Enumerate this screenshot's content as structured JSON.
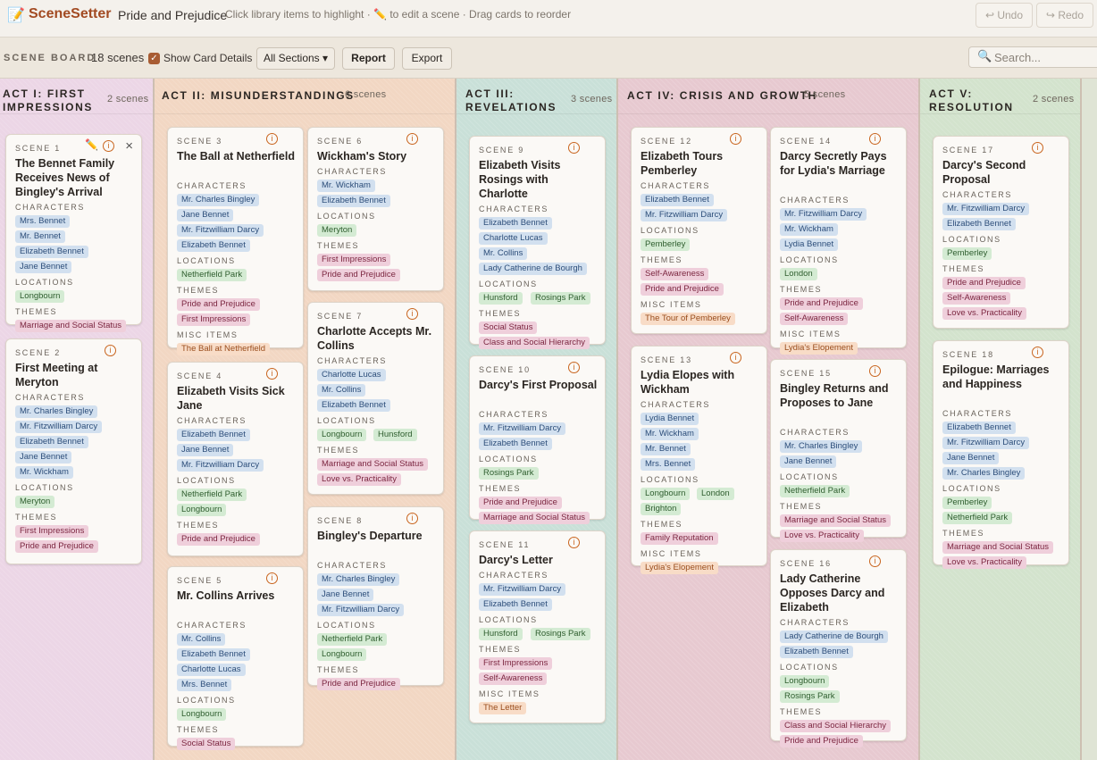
{
  "app": {
    "logo_icon": "notepad-pencil-icon",
    "name": "SceneSetter",
    "document_title": "Pride and Prejudice",
    "hint": "Click library items to highlight · ✏️ to edit a scene · Drag cards to reorder",
    "undo": "↩ Undo",
    "redo": "↪ Redo"
  },
  "toolbar": {
    "board_label": "SCENE BOARD",
    "scene_count": "18 scenes",
    "show_details_label": "Show Card Details",
    "show_details_checked": true,
    "sections_label": "All Sections ▾",
    "report": "Report",
    "export": "Export",
    "search_placeholder": "Search..."
  },
  "colors": {
    "character": "#d2e0ef",
    "location": "#d4ebd3",
    "theme": "#efcfdb",
    "misc": "#f8dcc7",
    "accent": "#a24a22"
  },
  "acts": [
    {
      "title": "ACT I: FIRST IMPRESSIONS",
      "count": "2 scenes",
      "color": "#ecd6e6"
    },
    {
      "title": "ACT II: MISUNDERSTANDINGS",
      "count": "6 scenes",
      "color": "#f2d7c3"
    },
    {
      "title": "ACT III: REVELATIONS",
      "count": "3 scenes",
      "color": "#c9e0d8"
    },
    {
      "title": "ACT IV: CRISIS AND GROWTH",
      "count": "5 scenes",
      "color": "#e7c9d0"
    },
    {
      "title": "ACT V: RESOLUTION",
      "count": "2 scenes",
      "color": "#d3e3cd"
    }
  ],
  "scenes": {
    "s1": {
      "num": "SCENE 1",
      "title": "The Bennet Family Receives News of Bingley's Arrival",
      "characters": [
        "Mrs. Bennet",
        "Mr. Bennet",
        "Elizabeth Bennet",
        "Jane Bennet"
      ],
      "locations": [
        "Longbourn"
      ],
      "themes": [
        "Marriage and Social Status"
      ]
    },
    "s2": {
      "num": "SCENE 2",
      "title": "First Meeting at Meryton",
      "characters": [
        "Mr. Charles Bingley",
        "Mr. Fitzwilliam Darcy",
        "Elizabeth Bennet",
        "Jane Bennet",
        "Mr. Wickham"
      ],
      "locations": [
        "Meryton"
      ],
      "themes": [
        "First Impressions",
        "Pride and Prejudice"
      ]
    },
    "s3": {
      "num": "SCENE 3",
      "title": "The Ball at Netherfield",
      "characters": [
        "Mr. Charles Bingley",
        "Jane Bennet",
        "Mr. Fitzwilliam Darcy",
        "Elizabeth Bennet"
      ],
      "locations": [
        "Netherfield Park"
      ],
      "themes": [
        "Pride and Prejudice",
        "First Impressions"
      ],
      "misc": [
        "The Ball at Netherfield"
      ]
    },
    "s4": {
      "num": "SCENE 4",
      "title": "Elizabeth Visits Sick Jane",
      "characters": [
        "Elizabeth Bennet",
        "Jane Bennet",
        "Mr. Fitzwilliam Darcy"
      ],
      "locations": [
        "Netherfield Park",
        "Longbourn"
      ],
      "themes": [
        "Pride and Prejudice"
      ]
    },
    "s5": {
      "num": "SCENE 5",
      "title": "Mr. Collins Arrives",
      "characters": [
        "Mr. Collins",
        "Elizabeth Bennet",
        "Charlotte Lucas",
        "Mrs. Bennet"
      ],
      "locations": [
        "Longbourn"
      ],
      "themes": [
        "Social Status"
      ]
    },
    "s6": {
      "num": "SCENE 6",
      "title": "Wickham's Story",
      "characters": [
        "Mr. Wickham",
        "Elizabeth Bennet"
      ],
      "locations": [
        "Meryton"
      ],
      "themes": [
        "First Impressions",
        "Pride and Prejudice"
      ]
    },
    "s7": {
      "num": "SCENE 7",
      "title": "Charlotte Accepts Mr. Collins",
      "characters": [
        "Charlotte Lucas",
        "Mr. Collins",
        "Elizabeth Bennet"
      ],
      "locations": [
        "Longbourn",
        "Hunsford"
      ],
      "themes": [
        "Marriage and Social Status",
        "Love vs. Practicality"
      ]
    },
    "s8": {
      "num": "SCENE 8",
      "title": "Bingley's Departure",
      "characters": [
        "Mr. Charles Bingley",
        "Jane Bennet",
        "Mr. Fitzwilliam Darcy"
      ],
      "locations": [
        "Netherfield Park",
        "Longbourn"
      ],
      "themes": [
        "Pride and Prejudice"
      ]
    },
    "s9": {
      "num": "SCENE 9",
      "title": "Elizabeth Visits Rosings with Charlotte",
      "characters": [
        "Elizabeth Bennet",
        "Charlotte Lucas",
        "Mr. Collins",
        "Lady Catherine de Bourgh"
      ],
      "locations": [
        "Hunsford",
        "Rosings Park"
      ],
      "themes": [
        "Social Status",
        "Class and Social Hierarchy"
      ]
    },
    "s10": {
      "num": "SCENE 10",
      "title": "Darcy's First Proposal",
      "characters": [
        "Mr. Fitzwilliam Darcy",
        "Elizabeth Bennet"
      ],
      "locations": [
        "Rosings Park"
      ],
      "themes": [
        "Pride and Prejudice",
        "Marriage and Social Status"
      ]
    },
    "s11": {
      "num": "SCENE 11",
      "title": "Darcy's Letter",
      "characters": [
        "Mr. Fitzwilliam Darcy",
        "Elizabeth Bennet"
      ],
      "locations": [
        "Hunsford",
        "Rosings Park"
      ],
      "themes": [
        "First Impressions",
        "Self-Awareness"
      ],
      "misc": [
        "The Letter"
      ]
    },
    "s12": {
      "num": "SCENE 12",
      "title": "Elizabeth Tours Pemberley",
      "characters": [
        "Elizabeth Bennet",
        "Mr. Fitzwilliam Darcy"
      ],
      "locations": [
        "Pemberley"
      ],
      "themes": [
        "Self-Awareness",
        "Pride and Prejudice"
      ],
      "misc": [
        "The Tour of Pemberley"
      ]
    },
    "s13": {
      "num": "SCENE 13",
      "title": "Lydia Elopes with Wickham",
      "characters": [
        "Lydia Bennet",
        "Mr. Wickham",
        "Mr. Bennet",
        "Mrs. Bennet"
      ],
      "locations": [
        "Longbourn",
        "London",
        "Brighton"
      ],
      "themes": [
        "Family Reputation"
      ],
      "misc": [
        "Lydia's Elopement"
      ]
    },
    "s14": {
      "num": "SCENE 14",
      "title": "Darcy Secretly Pays for Lydia's Marriage",
      "characters": [
        "Mr. Fitzwilliam Darcy",
        "Mr. Wickham",
        "Lydia Bennet"
      ],
      "locations": [
        "London"
      ],
      "themes": [
        "Pride and Prejudice",
        "Self-Awareness"
      ],
      "misc": [
        "Lydia's Elopement"
      ]
    },
    "s15": {
      "num": "SCENE 15",
      "title": "Bingley Returns and Proposes to Jane",
      "characters": [
        "Mr. Charles Bingley",
        "Jane Bennet"
      ],
      "locations": [
        "Netherfield Park"
      ],
      "themes": [
        "Marriage and Social Status",
        "Love vs. Practicality"
      ]
    },
    "s16": {
      "num": "SCENE 16",
      "title": "Lady Catherine Opposes Darcy and Elizabeth",
      "characters": [
        "Lady Catherine de Bourgh",
        "Elizabeth Bennet"
      ],
      "locations": [
        "Longbourn",
        "Rosings Park"
      ],
      "themes": [
        "Class and Social Hierarchy",
        "Pride and Prejudice"
      ]
    },
    "s17": {
      "num": "SCENE 17",
      "title": "Darcy's Second Proposal",
      "characters": [
        "Mr. Fitzwilliam Darcy",
        "Elizabeth Bennet"
      ],
      "locations": [
        "Pemberley"
      ],
      "themes": [
        "Pride and Prejudice",
        "Self-Awareness",
        "Love vs. Practicality"
      ]
    },
    "s18": {
      "num": "SCENE 18",
      "title": "Epilogue: Marriages and Happiness",
      "characters": [
        "Elizabeth Bennet",
        "Mr. Fitzwilliam Darcy",
        "Jane Bennet",
        "Mr. Charles Bingley"
      ],
      "locations": [
        "Pemberley",
        "Netherfield Park"
      ],
      "themes": [
        "Marriage and Social Status",
        "Love vs. Practicality"
      ]
    }
  },
  "labels": {
    "characters": "CHARACTERS",
    "locations": "LOCATIONS",
    "themes": "THEMES",
    "misc": "MISC ITEMS",
    "info_icon": "i",
    "edit_icon": "✏️",
    "close_icon": "×"
  }
}
